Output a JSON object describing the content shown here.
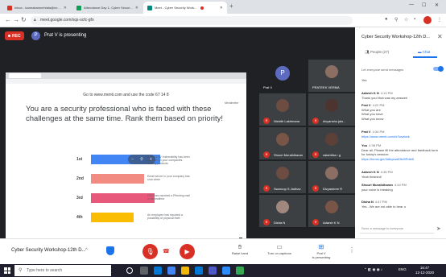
{
  "browser": {
    "tabs": [
      {
        "title": "Inbox - karmakarsnehlata@ex...",
        "color": "#d93025",
        "active": false
      },
      {
        "title": "Attendance Day 1- Cyber Securi...",
        "color": "#0f9d58",
        "active": false
      },
      {
        "title": "Meet - Cyber Security Work...",
        "color": "#00897b",
        "active": true
      }
    ],
    "new_tab": "+",
    "url": "meet.google.com/xqs-scfc-gfo",
    "controls": {
      "minimize": "—",
      "maximize": "☐",
      "close": "✕"
    }
  },
  "meet": {
    "rec_label": "REC",
    "presenter_initial": "P",
    "presenting_text": "Prat V is presenting",
    "slide": {
      "url_text": "Go to www.menti.com and use the code 67 14 8",
      "title": "You are a security professional who is faced with these challenges at the same time. Rank them based on priority!",
      "logo": "Mentimeter",
      "rows": [
        {
          "rank": "1st",
          "color": "#4285f4",
          "text": "A Zero Day Vulnerability has been identified in your companies leading products",
          "fill": 0.78
        },
        {
          "rank": "2nd",
          "color": "#f28b82",
          "text": "Email server in your company has shut down",
          "fill": 0.6
        },
        {
          "rank": "3rd",
          "color": "#e8587a",
          "text": "CEO has reported a Phishing mail in his mailbox",
          "fill": 0.72
        },
        {
          "rank": "4th",
          "color": "#fbbc04",
          "text": "An employee has reported a possibility of physical theft",
          "fill": 0.48
        }
      ]
    },
    "participants": [
      {
        "name": "Prat V",
        "initial": "P",
        "color": "#5c6bc0",
        "muted": false
      },
      {
        "name": "PRATEEK VERMA",
        "initial": "",
        "color": "#8d6e63",
        "muted": false
      },
      {
        "name": "Nishith Lakhmana",
        "initial": "",
        "color": "#6d4c41",
        "muted": true
      },
      {
        "name": "divyanshu jais...",
        "initial": "",
        "color": "#4e342e",
        "muted": true
      },
      {
        "name": "Shouri Muralidharan",
        "initial": "",
        "color": "#795548",
        "muted": true
      },
      {
        "name": "rakshitha r g",
        "initial": "",
        "color": "#5d4037",
        "muted": true
      },
      {
        "name": "Swaroop S Jadhav",
        "initial": "",
        "color": "#6d4c41",
        "muted": true
      },
      {
        "name": "Divyashree R",
        "initial": "",
        "color": "#8d6e63",
        "muted": true
      },
      {
        "name": "Disha N",
        "initial": "",
        "color": "#a1887f",
        "muted": true
      },
      {
        "name": "Adarsh K N",
        "initial": "",
        "color": "#795548",
        "muted": true
      }
    ]
  },
  "panel": {
    "title": "Cyber Security Workshop-12th D...",
    "close": "✕",
    "tabs": [
      {
        "label": "People (27)",
        "icon": "people-icon"
      },
      {
        "label": "Chat",
        "icon": "chat-icon"
      }
    ],
    "toggle_label": "Let everyone send messages",
    "messages": [
      {
        "who": "",
        "time": "",
        "lines": [
          "Yes"
        ]
      },
      {
        "who": "Adarsh K N",
        "time": "4:13 PM",
        "lines": [
          "Thank you! that was my answer!"
        ]
      },
      {
        "who": "Prat V",
        "time": "4:22 PM",
        "lines": [
          "What you are",
          "What you have",
          "What you know"
        ]
      },
      {
        "who": "Prat V",
        "time": "4:34 PM",
        "lines": [
          "https://www.menti.com/rk7wwfoxk"
        ],
        "link": true
      },
      {
        "who": "You",
        "time": "4:35 PM",
        "lines": [
          "Dear all, Please fill the attendance and feedback form for today's session:",
          "https://forms.gle/3d6qxwsE8d9Pdkt5"
        ]
      },
      {
        "who": "Adarsh K N",
        "time": "4:35 PM",
        "lines": [
          "Yeah finished!"
        ]
      },
      {
        "who": "Shouri Muralidharan",
        "time": "4:44 PM",
        "lines": [
          "your voice is breaking"
        ]
      },
      {
        "who": "Disha N",
        "time": "4:47 PM",
        "lines": [
          "Yes.. We are not able to hear u"
        ]
      }
    ],
    "input_placeholder": "Send a message to everyone",
    "send": "➤"
  },
  "controls": {
    "meeting_name": "Cyber Security Workshop-12th D...",
    "chevron": "^",
    "raise_hand": "Raise hand",
    "captions": "Turn on captions",
    "presenting_line1": "Prat V",
    "presenting_line2": "is presenting",
    "more": "⋮"
  },
  "taskbar": {
    "search_placeholder": "Type here to search",
    "lang": "ENG",
    "time": "16:47",
    "date": "12-12-2020"
  }
}
